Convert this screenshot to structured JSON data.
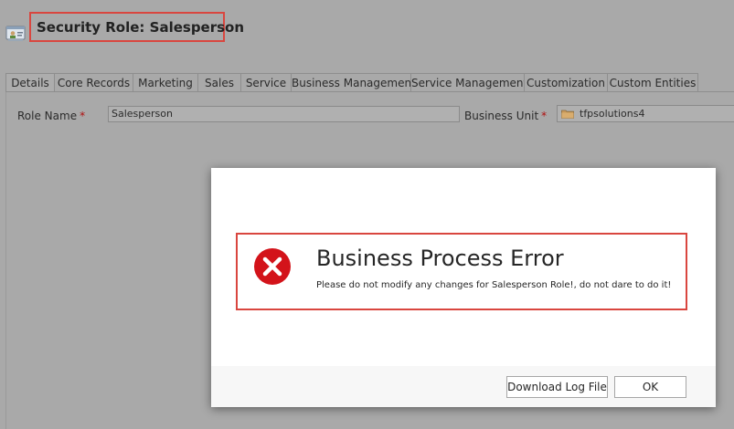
{
  "header": {
    "title": "Security Role: Salesperson",
    "icon": "security-role-icon"
  },
  "tabs": [
    {
      "label": "Details",
      "active": true
    },
    {
      "label": "Core Records"
    },
    {
      "label": "Marketing"
    },
    {
      "label": "Sales"
    },
    {
      "label": "Service"
    },
    {
      "label": "Business Management"
    },
    {
      "label": "Service Management"
    },
    {
      "label": "Customization"
    },
    {
      "label": "Custom Entities"
    }
  ],
  "form": {
    "role_name_label": "Role Name",
    "role_name_value": "Salesperson",
    "business_unit_label": "Business Unit",
    "business_unit_value": "tfpsolutions4",
    "required_marker": "*"
  },
  "dialog": {
    "title": "Business Process Error",
    "message": "Please do not modify any changes for Salesperson Role!, do not dare to do it!",
    "download_button": "Download Log File",
    "ok_button": "OK",
    "error_icon": "error-x-icon"
  },
  "colors": {
    "highlight_border": "#d9463f",
    "error_icon": "#d3131a",
    "background_dim": "#a9a9a9"
  }
}
